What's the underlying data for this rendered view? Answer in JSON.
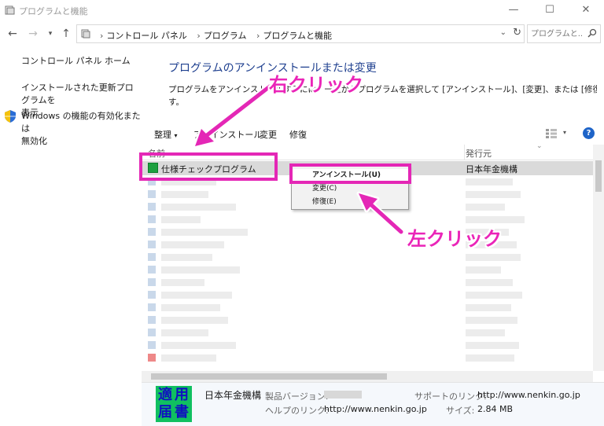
{
  "window": {
    "title": "プログラムと機能",
    "controls": [
      "—",
      "☐",
      "✕"
    ]
  },
  "address": {
    "crumbs": [
      "コントロール パネル",
      "プログラム",
      "プログラムと機能"
    ],
    "search_placeholder": "プログラムと..."
  },
  "sidebar": {
    "home": "コントロール パネル ホーム",
    "updates_line1": "インストールされた更新プログラムを",
    "updates_line2": "表示",
    "features_line1": "Windows の機能の有効化または",
    "features_line2": "無効化"
  },
  "main": {
    "heading": "プログラムのアンインストールまたは変更",
    "desc_line1": "プログラムをアンインストールするには、一覧からプログラムを選択して [アンインストール]、[変更]、または [修復] をクリックしま",
    "desc_line2": "す。"
  },
  "toolbar": {
    "organize": "整理",
    "uninstall": "アンインストール",
    "change": "変更",
    "repair": "修復"
  },
  "list": {
    "col_name": "名前",
    "col_publisher": "発行元",
    "selected_row": {
      "name": "仕様チェックプログラム",
      "publisher": "日本年金機構"
    }
  },
  "context_menu": {
    "items": [
      "アンインストール(U)",
      "変更(C)",
      "修復(E)"
    ]
  },
  "annotations": {
    "right_click": "右クリック",
    "left_click": "左クリック",
    "color": "#e427b6"
  },
  "details": {
    "badge_chars": [
      "適",
      "用",
      "届",
      "書"
    ],
    "publisher": "日本年金機構",
    "version_label": "製品バージョン:",
    "help_label": "ヘルプのリンク:",
    "help_url": "http://www.nenkin.go.jp",
    "support_label": "サポートのリンク:",
    "support_url": "http://www.nenkin.go.jp",
    "size_label": "サイズ:",
    "size_value": "2.84 MB"
  }
}
